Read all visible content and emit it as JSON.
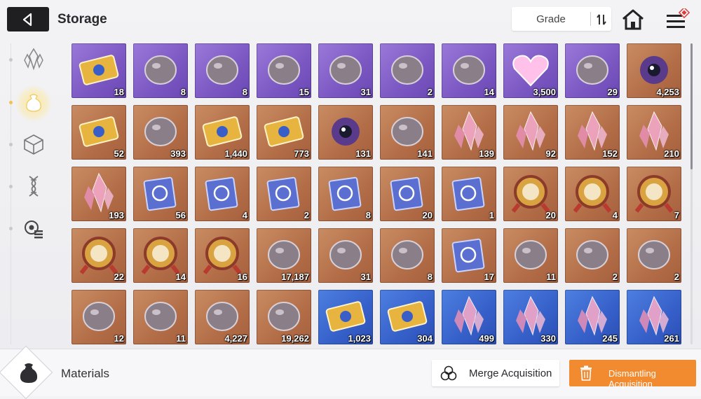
{
  "header": {
    "title": "Storage",
    "sort_label": "Grade"
  },
  "sidebar": {
    "items": [
      {
        "name": "crystal-icon",
        "active": false
      },
      {
        "name": "pouch-icon",
        "active": true
      },
      {
        "name": "cube-icon",
        "active": false
      },
      {
        "name": "dna-icon",
        "active": false
      },
      {
        "name": "gear-list-icon",
        "active": false
      }
    ]
  },
  "footer": {
    "category_label": "Materials",
    "merge_label": "Merge Acquisition",
    "dismantle_label": "Dismantling Acquisition"
  },
  "colors": {
    "orange_tile": "#b36e48",
    "purple_tile": "#7b57c2",
    "blue_tile": "#3660c9",
    "dismantle_button": "#f28a2f"
  },
  "items": [
    {
      "icon": "card-icon",
      "count": "18",
      "rarity": "purple"
    },
    {
      "icon": "head-icon",
      "count": "8",
      "rarity": "purple"
    },
    {
      "icon": "rock-icon",
      "count": "8",
      "rarity": "purple"
    },
    {
      "icon": "orb-icon",
      "count": "15",
      "rarity": "purple"
    },
    {
      "icon": "skull-icon",
      "count": "31",
      "rarity": "purple"
    },
    {
      "icon": "stone-face-icon",
      "count": "2",
      "rarity": "purple"
    },
    {
      "icon": "ore-icon",
      "count": "14",
      "rarity": "purple"
    },
    {
      "icon": "heart-icon",
      "count": "3,500",
      "rarity": "purple"
    },
    {
      "icon": "shell-icon",
      "count": "29",
      "rarity": "purple"
    },
    {
      "icon": "eye-icon",
      "count": "4,253",
      "rarity": "orange"
    },
    {
      "icon": "chip-icon",
      "count": "52",
      "rarity": "orange"
    },
    {
      "icon": "sphere-icon",
      "count": "393",
      "rarity": "orange"
    },
    {
      "icon": "ticket-icon",
      "count": "1,440",
      "rarity": "orange"
    },
    {
      "icon": "ticket-icon",
      "count": "773",
      "rarity": "orange"
    },
    {
      "icon": "eye-icon",
      "count": "131",
      "rarity": "orange"
    },
    {
      "icon": "feather-icon",
      "count": "141",
      "rarity": "orange"
    },
    {
      "icon": "crystal-icon",
      "count": "139",
      "rarity": "orange"
    },
    {
      "icon": "crystal-icon",
      "count": "92",
      "rarity": "orange"
    },
    {
      "icon": "crystal-icon",
      "count": "152",
      "rarity": "orange"
    },
    {
      "icon": "crystal-icon",
      "count": "210",
      "rarity": "orange"
    },
    {
      "icon": "crystal-icon",
      "count": "193",
      "rarity": "orange"
    },
    {
      "icon": "book-icon",
      "count": "56",
      "rarity": "orange"
    },
    {
      "icon": "book-icon",
      "count": "4",
      "rarity": "orange"
    },
    {
      "icon": "book-icon",
      "count": "2",
      "rarity": "orange"
    },
    {
      "icon": "book-icon",
      "count": "8",
      "rarity": "orange"
    },
    {
      "icon": "book-icon",
      "count": "20",
      "rarity": "orange"
    },
    {
      "icon": "book-icon",
      "count": "1",
      "rarity": "orange"
    },
    {
      "icon": "medal-icon",
      "count": "20",
      "rarity": "orange"
    },
    {
      "icon": "medal-icon",
      "count": "4",
      "rarity": "orange"
    },
    {
      "icon": "medal-icon",
      "count": "7",
      "rarity": "orange"
    },
    {
      "icon": "medal-icon",
      "count": "22",
      "rarity": "orange"
    },
    {
      "icon": "medal-icon",
      "count": "14",
      "rarity": "orange"
    },
    {
      "icon": "medal-icon",
      "count": "16",
      "rarity": "orange"
    },
    {
      "icon": "shard-icon",
      "count": "17,187",
      "rarity": "orange"
    },
    {
      "icon": "gem-icon",
      "count": "31",
      "rarity": "orange"
    },
    {
      "icon": "shoes-icon",
      "count": "8",
      "rarity": "orange"
    },
    {
      "icon": "tome-icon",
      "count": "17",
      "rarity": "orange"
    },
    {
      "icon": "spray-gun-icon",
      "count": "11",
      "rarity": "orange"
    },
    {
      "icon": "cards-icon",
      "count": "2",
      "rarity": "orange"
    },
    {
      "icon": "letter-icon",
      "count": "2",
      "rarity": "orange"
    },
    {
      "icon": "dreamcatcher-icon",
      "count": "12",
      "rarity": "orange"
    },
    {
      "icon": "pick-icon",
      "count": "11",
      "rarity": "orange"
    },
    {
      "icon": "urchin-icon",
      "count": "4,227",
      "rarity": "orange"
    },
    {
      "icon": "crystal-cluster-icon",
      "count": "19,262",
      "rarity": "orange"
    },
    {
      "icon": "ticket-icon",
      "count": "1,023",
      "rarity": "blue"
    },
    {
      "icon": "ticket-icon",
      "count": "304",
      "rarity": "blue"
    },
    {
      "icon": "crystal-icon",
      "count": "499",
      "rarity": "blue"
    },
    {
      "icon": "crystal-icon",
      "count": "330",
      "rarity": "blue"
    },
    {
      "icon": "crystal-icon",
      "count": "245",
      "rarity": "blue"
    },
    {
      "icon": "crystal-icon",
      "count": "261",
      "rarity": "blue"
    }
  ]
}
